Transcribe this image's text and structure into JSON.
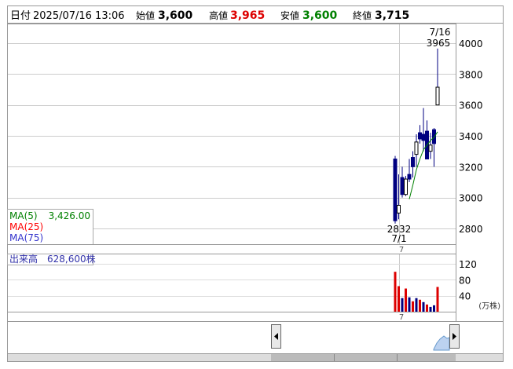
{
  "header": {
    "date_label": "日付",
    "datetime": "2025/07/16 13:06",
    "open_label": "始値",
    "open_value": "3,600",
    "high_label": "高値",
    "high_value": "3,965",
    "low_label": "安値",
    "low_value": "3,600",
    "close_label": "終値",
    "close_value": "3,715"
  },
  "legend": {
    "ma5_label": "MA(5)",
    "ma5_value": "3,426.00",
    "ma25_label": "MA(25)",
    "ma75_label": "MA(75)"
  },
  "volume_legend": {
    "label": "出来高",
    "value": "628,600株"
  },
  "colors": {
    "up": "#ffffff",
    "down": "#000080",
    "ma5": "#008000",
    "ma25": "#ff0000",
    "ma75": "#3333cc",
    "volume": "#dd0000",
    "volume_alt": "#000080",
    "high_text": "#dd0000",
    "low_text": "#008000",
    "grid": "#cccccc"
  },
  "chart_data": [
    {
      "type": "candlestick",
      "yaxis": {
        "ticks": [
          2800,
          3000,
          3200,
          3400,
          3600,
          3800,
          4000
        ],
        "ylim": [
          2700,
          4100
        ]
      },
      "xaxis_tick": "7",
      "annotations": {
        "high_date": "7/16",
        "high_value": "3965",
        "low_value": "2832",
        "low_date": "7/1"
      },
      "candles": [
        {
          "o": 3250,
          "h": 3270,
          "l": 2832,
          "c": 2850
        },
        {
          "o": 2900,
          "h": 3150,
          "l": 2860,
          "c": 2950
        },
        {
          "o": 3130,
          "h": 3200,
          "l": 3000,
          "c": 3020
        },
        {
          "o": 3020,
          "h": 3140,
          "l": 3010,
          "c": 3120
        },
        {
          "o": 3150,
          "h": 3250,
          "l": 3100,
          "c": 3120
        },
        {
          "o": 3260,
          "h": 3300,
          "l": 3130,
          "c": 3200
        },
        {
          "o": 3280,
          "h": 3410,
          "l": 3200,
          "c": 3360
        },
        {
          "o": 3420,
          "h": 3470,
          "l": 3350,
          "c": 3380
        },
        {
          "o": 3410,
          "h": 3580,
          "l": 3300,
          "c": 3370
        },
        {
          "o": 3430,
          "h": 3500,
          "l": 3310,
          "c": 3250
        },
        {
          "o": 3300,
          "h": 3420,
          "l": 3250,
          "c": 3340
        },
        {
          "o": 3440,
          "h": 3450,
          "l": 3200,
          "c": 3350
        },
        {
          "o": 3600,
          "h": 3965,
          "l": 3600,
          "c": 3715
        }
      ],
      "ma5": [
        null,
        null,
        null,
        null,
        2990,
        3080,
        3180,
        3250,
        3310,
        3340,
        3370,
        3390,
        3426
      ]
    },
    {
      "type": "bar",
      "name": "出来高",
      "yaxis": {
        "ticks": [
          40,
          80,
          120
        ],
        "ylim": [
          0,
          135
        ],
        "unit": "(万株)"
      },
      "xaxis_tick": "7",
      "values": [
        100,
        64,
        34,
        58,
        36,
        26,
        34,
        30,
        24,
        18,
        12,
        16,
        62
      ],
      "bar_colors": [
        "volume",
        "volume",
        "volume_alt",
        "volume",
        "volume_alt",
        "volume",
        "volume_alt",
        "volume",
        "volume_alt",
        "volume",
        "volume_alt",
        "volume_alt",
        "volume"
      ]
    }
  ]
}
